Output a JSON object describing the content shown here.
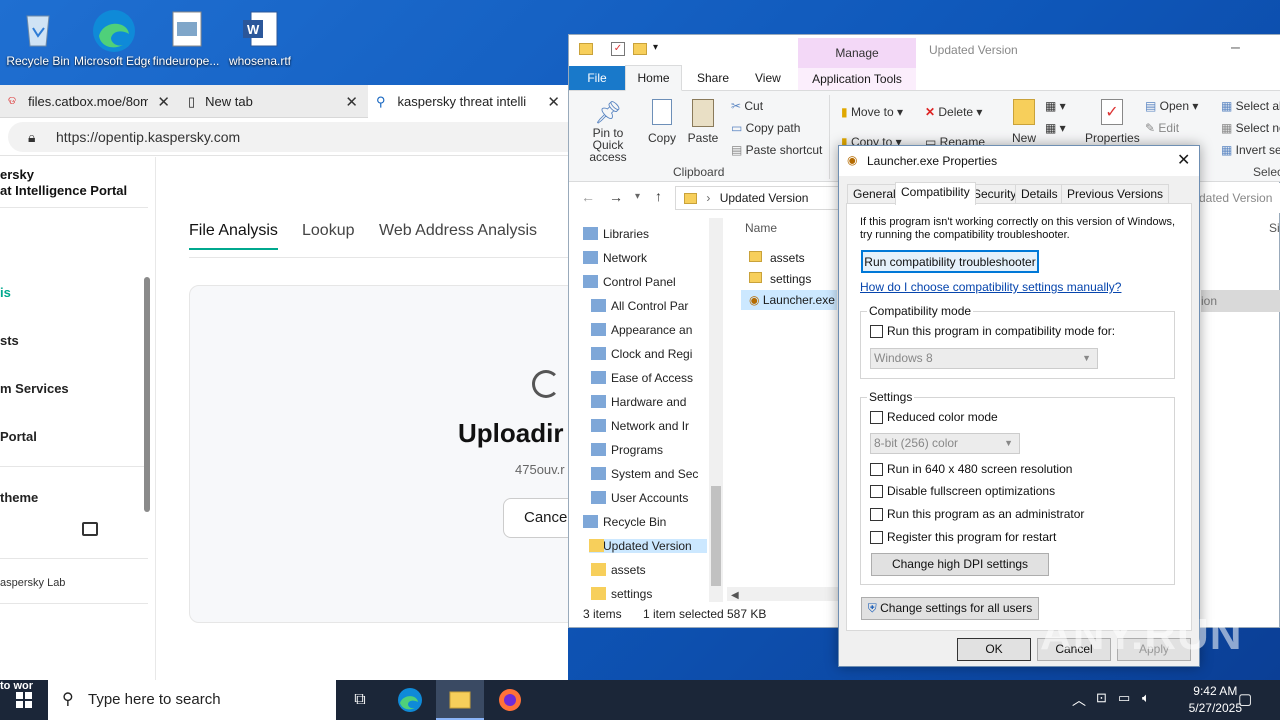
{
  "desktop": {
    "icons": [
      {
        "label": "Recycle Bin"
      },
      {
        "label": "Microsoft Edge"
      },
      {
        "label": "findeurope..."
      },
      {
        "label": "whosena.rtf"
      }
    ]
  },
  "browser": {
    "tabs": [
      {
        "label": "files.catbox.moe/8om"
      },
      {
        "label": "New tab"
      },
      {
        "label": "kaspersky threat intelli"
      }
    ],
    "url": "https://opentip.kaspersky.com",
    "brand_line1": "ersky",
    "brand_line2": "at Intelligence Portal",
    "nav_items": [
      "is",
      "sts",
      "m Services",
      "Portal",
      "theme"
    ],
    "footer": "aspersky Lab",
    "page_tabs": [
      "File Analysis",
      "Lookup",
      "Web Address Analysis"
    ],
    "upload_title": "Uploadir",
    "upload_file": "475ouv.r",
    "cancel_label": "Cance"
  },
  "explorer": {
    "quick_access_title": "Updated Version",
    "manage_label": "Manage",
    "ribbon_tabs": [
      "File",
      "Home",
      "Share",
      "View",
      "Application Tools"
    ],
    "clipboard": {
      "pin": "Pin to Quick access",
      "copy": "Copy",
      "paste": "Paste",
      "cut": "Cut",
      "copy_path": "Copy path",
      "paste_shortcut": "Paste shortcut",
      "group": "Clipboard"
    },
    "organize": {
      "move_to": "Move to",
      "delete": "Delete",
      "copy_to": "Copy to",
      "rename": "Rename"
    },
    "new_label": "New",
    "properties_label": "Properties",
    "open_label": "Open",
    "edit_label": "Edit",
    "select_all": "Select al",
    "select_none": "Select no",
    "invert": "Invert se",
    "select_group": "Selec",
    "breadcrumb": "Updated Version",
    "right_breadcrumb": "dated Version",
    "column_name": "Name",
    "column_size": "Siz",
    "tree": [
      "Libraries",
      "Network",
      "Control Panel",
      "All Control Par",
      "Appearance an",
      "Clock and Regi",
      "Ease of Access",
      "Hardware and",
      "Network and Ir",
      "Programs",
      "System and Sec",
      "User Accounts",
      "Recycle Bin",
      "Updated Version",
      "assets",
      "settings"
    ],
    "files": [
      "assets",
      "settings",
      "Launcher.exe"
    ],
    "right_partial": "ion",
    "status_items": "3 items",
    "status_selected": "1 item selected",
    "status_size": "587 KB"
  },
  "dialog": {
    "title": "Launcher.exe Properties",
    "tabs": [
      "General",
      "Compatibility",
      "Security",
      "Details",
      "Previous Versions"
    ],
    "intro": "If this program isn't working correctly on this version of Windows, try running the compatibility troubleshooter.",
    "troubleshooter_btn": "Run compatibility troubleshooter",
    "manual_link": "How do I choose compatibility settings manually?",
    "compat_group": "Compatibility mode",
    "compat_check": "Run this program in compatibility mode for:",
    "compat_value": "Windows 8",
    "settings_group": "Settings",
    "reduced_color": "Reduced color mode",
    "color_value": "8-bit (256) color",
    "res_640": "Run in 640 x 480 screen resolution",
    "disable_fs": "Disable fullscreen optimizations",
    "run_admin": "Run this program as an administrator",
    "register_restart": "Register this program for restart",
    "dpi_btn": "Change high DPI settings",
    "all_users_btn": "Change settings for all users",
    "ok": "OK",
    "cancel": "Cancel",
    "apply": "Apply"
  },
  "taskbar": {
    "search_placeholder": "Type here to search",
    "time": "9:42 AM",
    "date": "5/27/2025",
    "partial_left": "to wor"
  },
  "watermark": "ANY.RUN"
}
